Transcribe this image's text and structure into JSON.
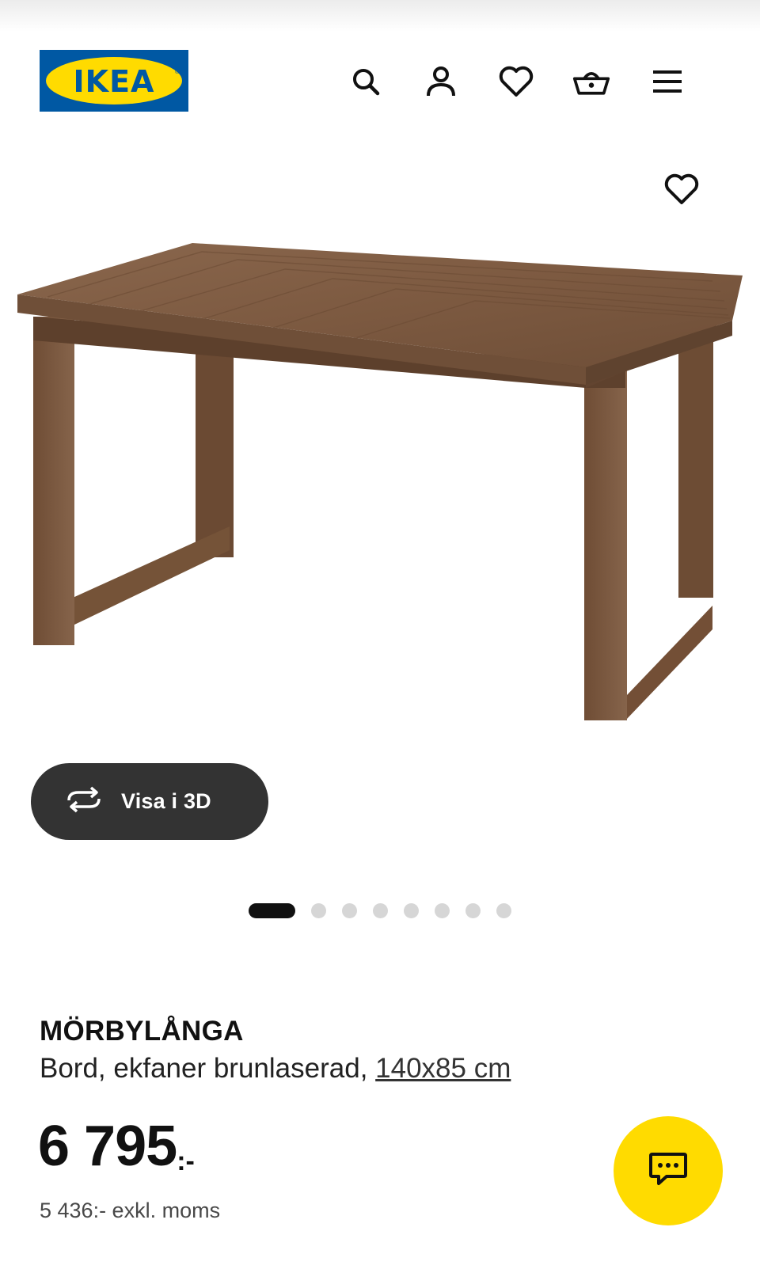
{
  "brand": {
    "logo_text": "IKEA",
    "logo_blue": "#0058a3",
    "logo_yellow": "#ffdb00"
  },
  "header": {
    "icons": [
      "search-icon",
      "account-icon",
      "heart-icon",
      "basket-icon",
      "menu-icon"
    ]
  },
  "gallery": {
    "view_3d_label": "Visa i 3D",
    "image_count": 8,
    "active_index": 0
  },
  "product": {
    "name": "MÖRBYLÅNGA",
    "description": "Bord, ekfaner brunlaserad,",
    "size_link": "140x85 cm",
    "price": "6 795",
    "price_suffix": ":-",
    "price_excl_vat": "5 436:- exkl. moms"
  },
  "colors": {
    "accent": "#ffdb00",
    "dark_button": "#333333",
    "dot_inactive": "#d6d6d6"
  }
}
